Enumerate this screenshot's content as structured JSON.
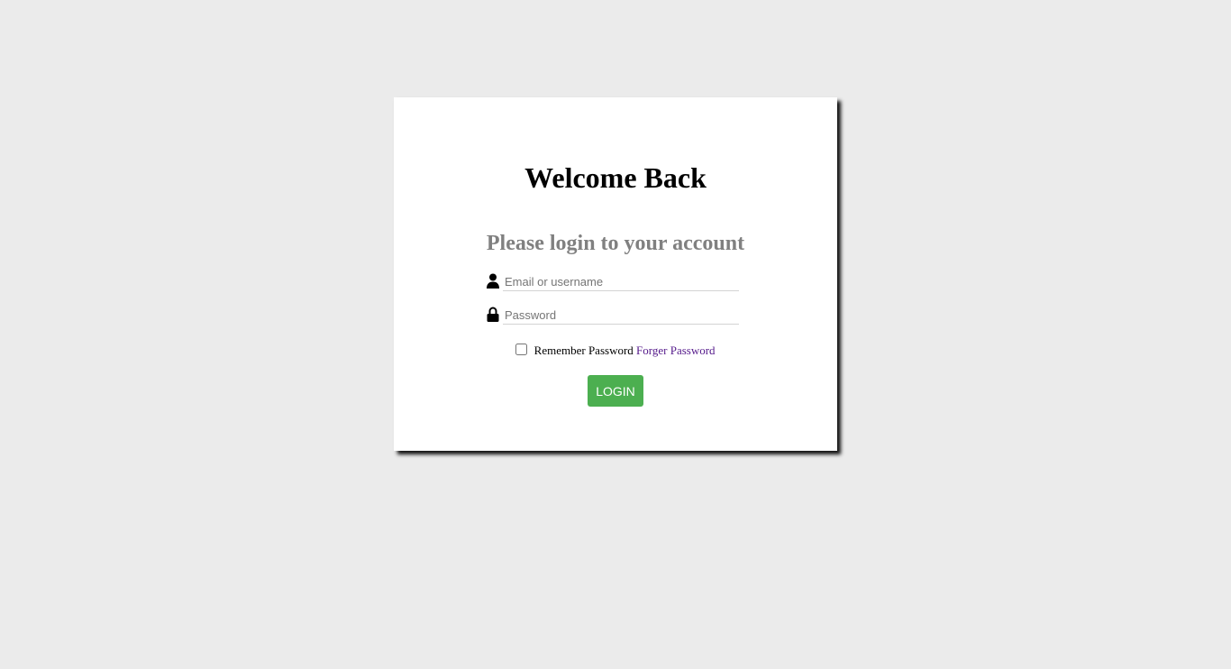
{
  "login": {
    "title": "Welcome Back",
    "subtitle": "Please login to your account",
    "username": {
      "placeholder": "Email or username",
      "value": "",
      "icon": "user-icon"
    },
    "password": {
      "placeholder": "Password",
      "value": "",
      "icon": "lock-icon"
    },
    "remember_label": "Remember Password",
    "remember_checked": false,
    "forgot_link": "Forger Password",
    "submit_label": "LOGIN"
  },
  "colors": {
    "background": "#ebebeb",
    "card": "#ffffff",
    "subtitle": "#808080",
    "button": "#4caf50",
    "link": "#551a8b"
  }
}
